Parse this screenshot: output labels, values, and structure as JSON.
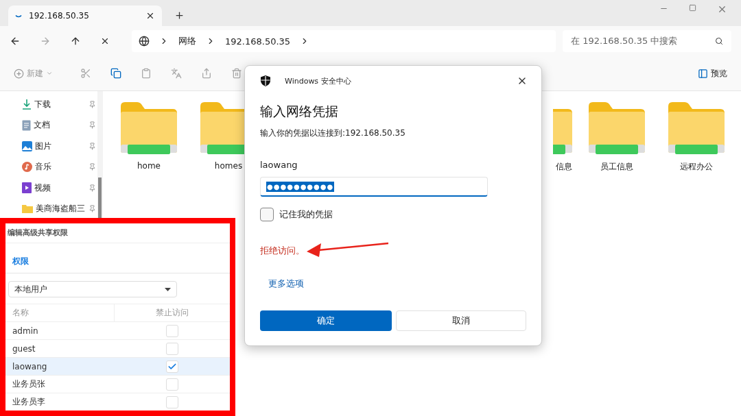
{
  "browser_tab": {
    "title": "192.168.50.35"
  },
  "address_bar": {
    "segments": [
      "网络",
      "192.168.50.35"
    ]
  },
  "search": {
    "placeholder": "在 192.168.50.35 中搜索"
  },
  "toolbar": {
    "new_label": "新建",
    "preview_label": "预览"
  },
  "sidebar": {
    "items": [
      {
        "label": "下载",
        "kind": "download"
      },
      {
        "label": "文档",
        "kind": "document"
      },
      {
        "label": "图片",
        "kind": "picture"
      },
      {
        "label": "音乐",
        "kind": "music"
      },
      {
        "label": "视频",
        "kind": "video"
      },
      {
        "label": "美商海盗船三",
        "kind": "folder"
      }
    ]
  },
  "folders": [
    {
      "label": "home",
      "kind": "full"
    },
    {
      "label": "homes",
      "kind": "full"
    },
    {
      "label": "信息",
      "kind": "partial"
    },
    {
      "label": "员工信息",
      "kind": "full"
    },
    {
      "label": "远程办公",
      "kind": "full"
    }
  ],
  "share_panel": {
    "title": "编辑高级共享权限",
    "tab": "权限",
    "dropdown": "本地用户",
    "columns": [
      "名称",
      "禁止访问"
    ],
    "rows": [
      {
        "name": "admin",
        "checked": false,
        "selected": false
      },
      {
        "name": "guest",
        "checked": false,
        "selected": false
      },
      {
        "name": "laowang",
        "checked": true,
        "selected": true
      },
      {
        "name": "业务员张",
        "checked": false,
        "selected": false
      },
      {
        "name": "业务员李",
        "checked": false,
        "selected": false
      }
    ]
  },
  "dialog": {
    "app": "Windows 安全中心",
    "title": "输入网络凭据",
    "subtitle": "输入你的凭据以连接到:192.168.50.35",
    "username": "laowang",
    "password": "●●●●●●●●●●",
    "remember": {
      "label": "记住我的凭据",
      "checked": false
    },
    "error": "拒绝访问。",
    "more": "更多选项",
    "ok": "确定",
    "cancel": "取消"
  }
}
